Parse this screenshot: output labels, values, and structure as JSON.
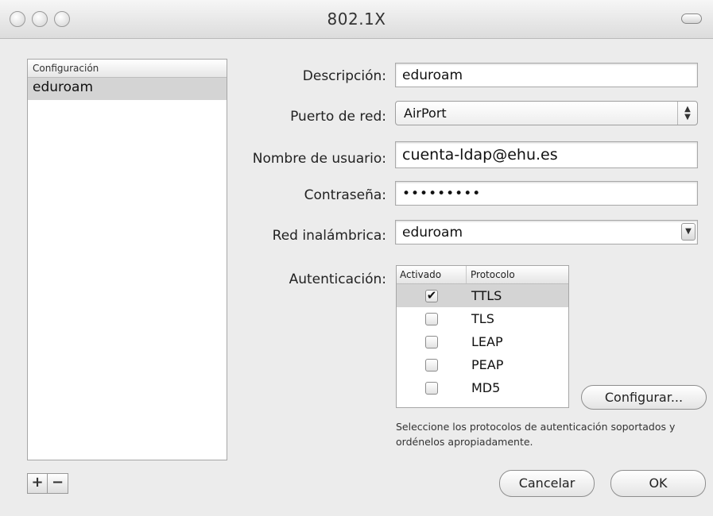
{
  "window": {
    "title": "802.1X"
  },
  "sidebar": {
    "header": "Configuración",
    "items": [
      {
        "label": "eduroam"
      }
    ],
    "add_label": "+",
    "remove_label": "−"
  },
  "form": {
    "descripcion": {
      "label": "Descripción:",
      "value": "eduroam"
    },
    "puerto": {
      "label": "Puerto de red:",
      "value": "AirPort"
    },
    "usuario": {
      "label": "Nombre de usuario:",
      "value": "cuenta-ldap@ehu.es"
    },
    "contrasena": {
      "label": "Contraseña:",
      "value": "•••••••••"
    },
    "red": {
      "label": "Red inalámbrica:",
      "value": "eduroam"
    },
    "autenticacion": {
      "label": "Autenticación:",
      "columns": [
        "Activado",
        "Protocolo"
      ],
      "rows": [
        {
          "protocol": "TTLS",
          "checked": true,
          "selected": true
        },
        {
          "protocol": "TLS",
          "checked": false,
          "selected": false
        },
        {
          "protocol": "LEAP",
          "checked": false,
          "selected": false
        },
        {
          "protocol": "PEAP",
          "checked": false,
          "selected": false
        },
        {
          "protocol": "MD5",
          "checked": false,
          "selected": false
        }
      ],
      "configure_label": "Configurar...",
      "help": "Seleccione los protocolos de autenticación soportados y ordénelos apropiadamente."
    }
  },
  "buttons": {
    "cancel": "Cancelar",
    "ok": "OK"
  },
  "icons": {
    "checkmark": "✔",
    "popup_up": "▲",
    "popup_down": "▼"
  }
}
